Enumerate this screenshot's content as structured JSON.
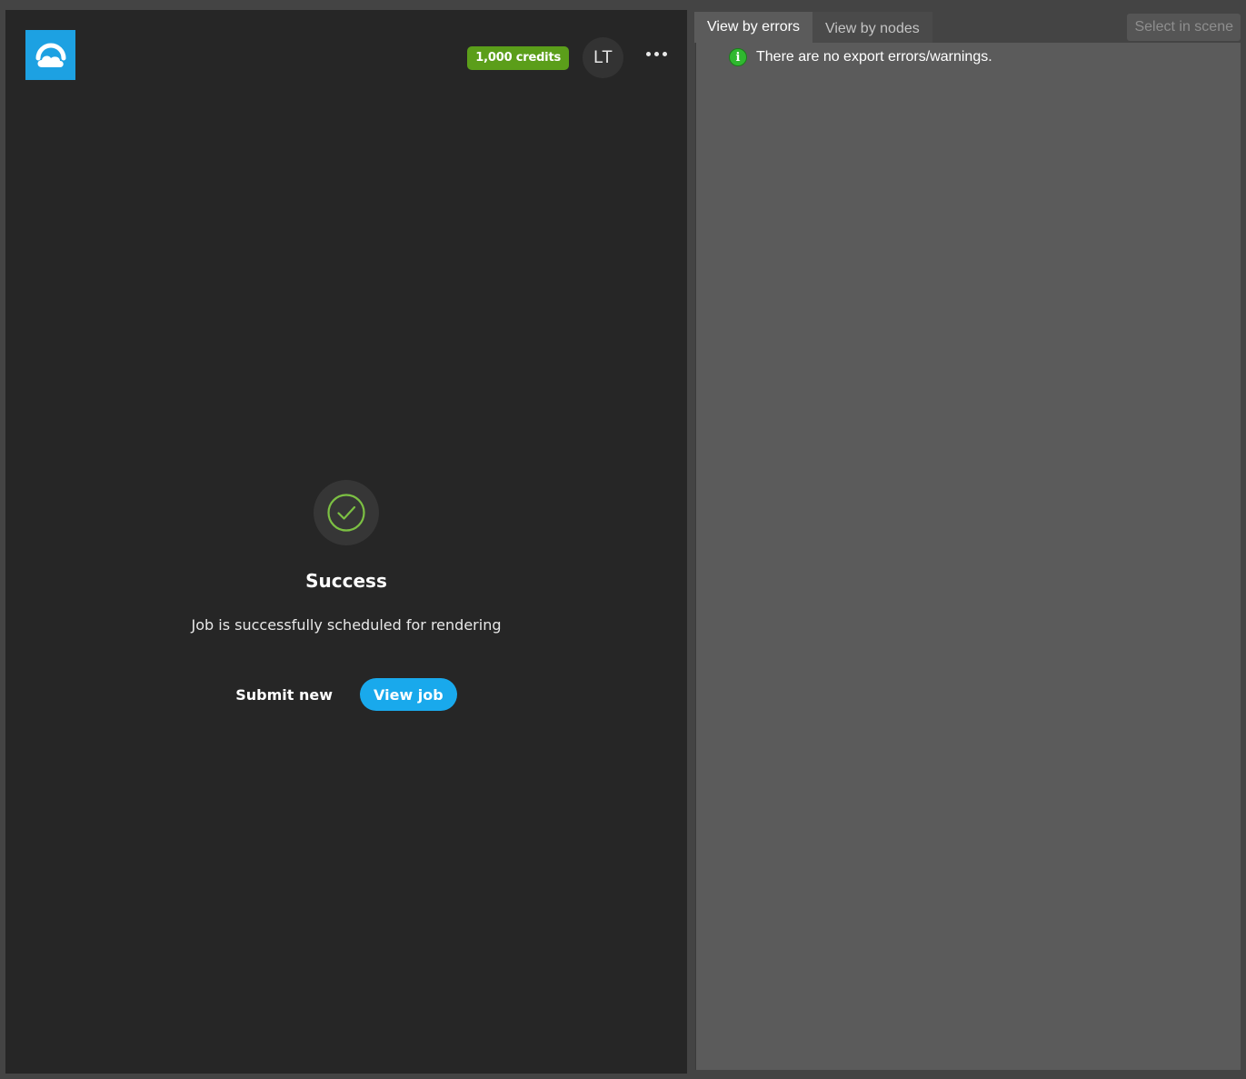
{
  "left_panel": {
    "logo_icon": "cloud-logo-icon",
    "credits": "1,000 credits",
    "avatar_initials": "LT",
    "more_icon": "more-horizontal-icon",
    "success": {
      "icon": "check-circle-icon",
      "title": "Success",
      "message": "Job is successfully scheduled for rendering",
      "submit_new_label": "Submit new",
      "view_job_label": "View job"
    }
  },
  "right_panel": {
    "tabs": [
      {
        "label": "View by errors",
        "active": true
      },
      {
        "label": "View by nodes",
        "active": false
      }
    ],
    "select_in_scene_label": "Select in scene",
    "info_icon": "info-icon",
    "message": "There are no export errors/warnings."
  },
  "colors": {
    "brand_blue": "#1da1e2",
    "credits_green": "#5b9e1a",
    "check_green": "#7cc043",
    "view_job_blue": "#19a9ec",
    "info_green": "#2fb82f"
  }
}
